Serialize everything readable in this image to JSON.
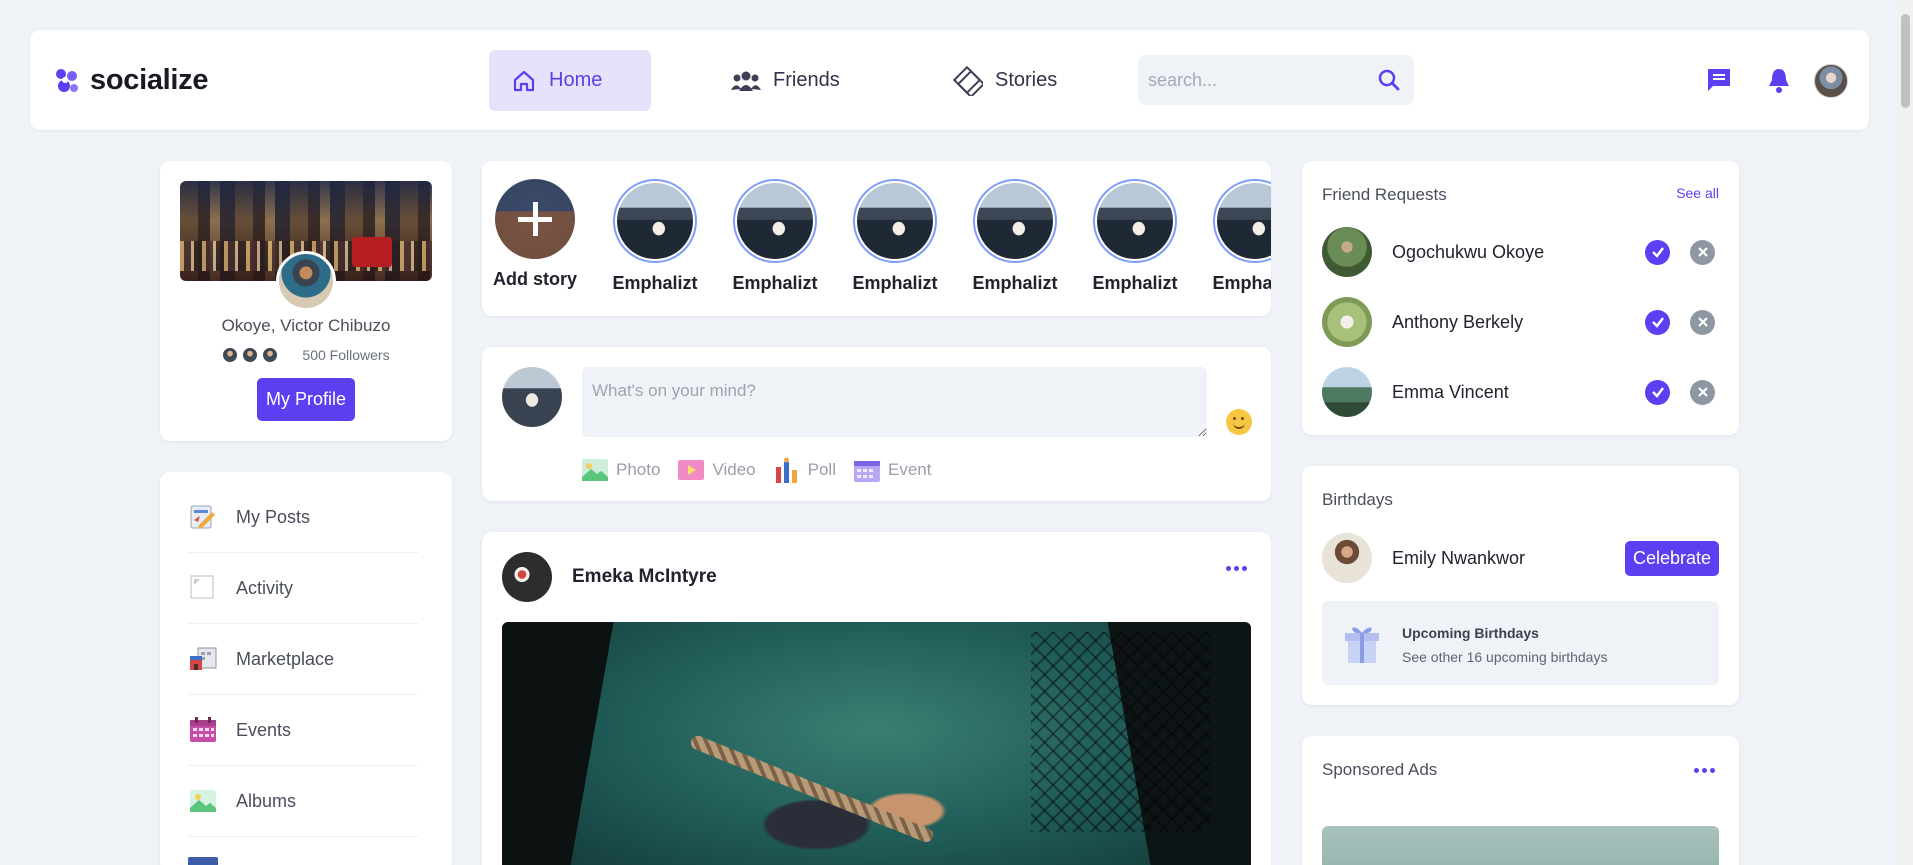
{
  "brand": {
    "name": "socialize"
  },
  "nav": {
    "home": "Home",
    "friends": "Friends",
    "stories": "Stories"
  },
  "search": {
    "placeholder": "search..."
  },
  "profile": {
    "name": "Okoye, Victor Chibuzo",
    "followers": "500 Followers",
    "button": "My Profile"
  },
  "menu": [
    {
      "label": "My Posts",
      "icon": "posts-icon"
    },
    {
      "label": "Activity",
      "icon": "activity-icon"
    },
    {
      "label": "Marketplace",
      "icon": "marketplace-icon"
    },
    {
      "label": "Events",
      "icon": "calendar-icon"
    },
    {
      "label": "Albums",
      "icon": "album-icon"
    }
  ],
  "stories": {
    "add_label": "Add story",
    "items": [
      "Emphalizt",
      "Emphalizt",
      "Emphalizt",
      "Emphalizt",
      "Emphalizt",
      "Emphalizt"
    ]
  },
  "composer": {
    "placeholder": "What's on your mind?",
    "actions": [
      "Photo",
      "Video",
      "Poll",
      "Event"
    ]
  },
  "post": {
    "author": "Emeka McIntyre"
  },
  "friend_requests": {
    "title": "Friend Requests",
    "see_all": "See all",
    "items": [
      {
        "name": "Ogochukwu Okoye"
      },
      {
        "name": "Anthony Berkely"
      },
      {
        "name": "Emma Vincent"
      }
    ]
  },
  "birthdays": {
    "title": "Birthdays",
    "person": "Emily Nwankwor",
    "button": "Celebrate",
    "upcoming_title": "Upcoming Birthdays",
    "upcoming_sub": "See other 16 upcoming birthdays"
  },
  "ads": {
    "title": "Sponsored Ads"
  },
  "colors": {
    "accent": "#5b3ff0",
    "background": "#eff2f7",
    "nav_active_bg": "#e7e2fc"
  }
}
